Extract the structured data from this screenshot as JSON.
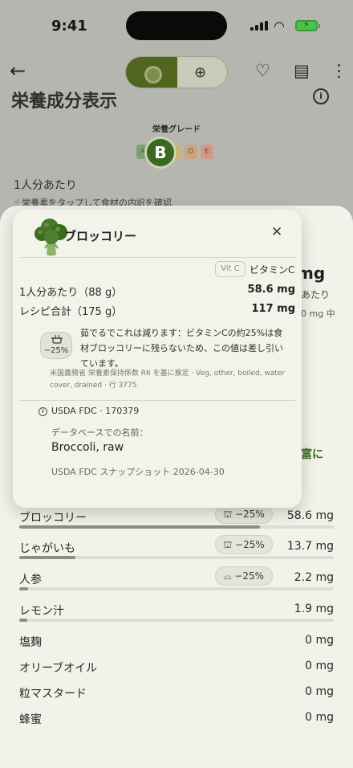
{
  "status": {
    "time": "9:41"
  },
  "header": {
    "title": "栄養成分表示"
  },
  "grade": {
    "label": "栄養グレード",
    "letters": [
      "A",
      "B",
      "C",
      "D",
      "E"
    ],
    "current": "B"
  },
  "per_serving_label": "1人分あたり",
  "tap_hint": "栄養素をタップして食材の内訳を確認",
  "sheet_peek": {
    "value": "mg",
    "per_label": "あたり",
    "daily": "0 mg 中",
    "green_text": "富に"
  },
  "popover": {
    "food_name": "ブロッコリー",
    "nutrient_tag": "Vit C",
    "nutrient_name": "ビタミンC",
    "rows": [
      {
        "label": "1人分あたり（88 g）",
        "value": "58.6 mg"
      },
      {
        "label": "レシピ合計（175 g）",
        "value": "117 mg"
      }
    ],
    "loss_chip": "−25%",
    "loss_note": "茹でるでこれは減ります：ビタミンCの約25%は食材ブロッコリーに残らないため、この値は差し引いています。",
    "loss_source": "米国農務省 栄養素保持係数 R6 を基に推定 · Veg, other, boiled, water cover, drained · 行 3775",
    "fdc_id": "USDA FDC · 170379",
    "db_label": "データベースでの名前：",
    "db_name": "Broccoli, raw",
    "snapshot": "USDA FDC スナップショット 2026-04-30"
  },
  "ingredients": [
    {
      "name": "ブロッコリー",
      "chip": "−25%",
      "chip_icon": "pot-icon",
      "value": "58.6 mg",
      "share": 0.77
    },
    {
      "name": "じゃがいも",
      "chip": "−25%",
      "chip_icon": "pot-icon",
      "value": "13.7 mg",
      "share": 0.18
    },
    {
      "name": "人参",
      "chip": "−25%",
      "chip_icon": "pan-icon",
      "value": "2.2 mg",
      "share": 0.03
    },
    {
      "name": "レモン汁",
      "chip": "",
      "chip_icon": "",
      "value": "1.9 mg",
      "share": 0.025
    },
    {
      "name": "塩麹",
      "value": "0 mg"
    },
    {
      "name": "オリーブオイル",
      "value": "0 mg"
    },
    {
      "name": "粒マスタード",
      "value": "0 mg"
    },
    {
      "name": "蜂蜜",
      "value": "0 mg"
    }
  ]
}
